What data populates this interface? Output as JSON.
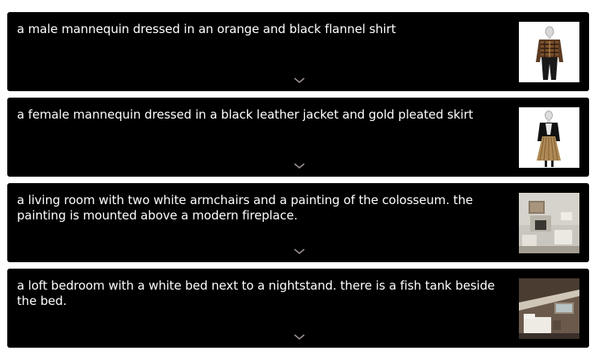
{
  "results": [
    {
      "caption": "a male mannequin dressed in an orange and black flannel shirt",
      "thumbnail_icon": "mannequin-flannel-shirt-image"
    },
    {
      "caption": "a female mannequin dressed in a black leather jacket and gold pleated skirt",
      "thumbnail_icon": "mannequin-leather-jacket-image"
    },
    {
      "caption": "a living room with two white armchairs and a painting of the colosseum. the painting is mounted above a modern fireplace.",
      "thumbnail_icon": "living-room-image"
    },
    {
      "caption": "a loft bedroom with a white bed next to a nightstand. there is a fish tank beside the bed.",
      "thumbnail_icon": "loft-bedroom-image"
    }
  ],
  "expand_icon": "chevron-down-icon",
  "colors": {
    "card_background": "#000000",
    "caption_text": "#ffffff",
    "chevron": "#9c8f96"
  }
}
